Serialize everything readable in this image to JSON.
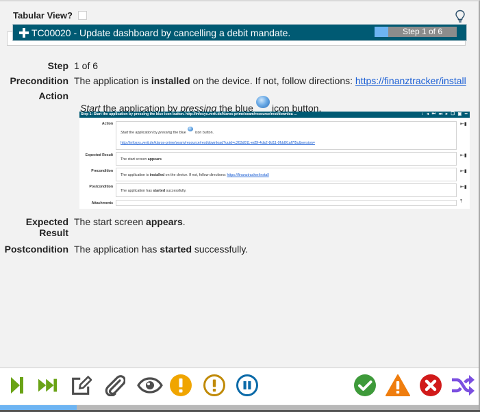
{
  "header": {
    "tabular_view_label": "Tabular View?",
    "tabular_view_checked": false,
    "test_case_title": "TC00020 - Update dashboard by cancelling a debit mandate.",
    "step_progress_label": "Step 1 of 6",
    "step_progress_fraction": 0.1667
  },
  "details": {
    "step_label": "Step",
    "step_value": "1 of 6",
    "precondition_label": "Precondition",
    "precondition_text_1": "The application is ",
    "precondition_bold": "installed",
    "precondition_text_2": " on the device. If not, follow directions: ",
    "precondition_link": "https://finanztracker/install",
    "action_label": "Action",
    "action_italic_1": "Start",
    "action_text_1": " the application by ",
    "action_italic_2": "pressing",
    "action_text_2": " the blue",
    "action_text_3": "icon button.",
    "expected_label": "Expected Result",
    "expected_text_1": "The start screen ",
    "expected_bold": "appears",
    "expected_text_2": ".",
    "postcondition_label": "Postcondition",
    "postcondition_text_1": "The application has ",
    "postcondition_bold": "started",
    "postcondition_text_2": " successfully."
  },
  "embedded_screenshot": {
    "title": "Step 1: Start the application by pressing the blue icon button. http://infosys.verit.de/klaros-prime/seam/resource/rest/downloa ...",
    "toolbar_glyphs": "↕ ◂ ⏮ ⏭ ▸ ❐ ▣ ━",
    "action_label": "Action",
    "action_italic_1": "Start",
    "action_text_1": " the application by ",
    "action_italic_2": "pressing",
    "action_text_2": " the blue ",
    "action_text_3": " icon button.",
    "action_link": "http://infosys.verit.de/klaros-prime/seam/resource/rest/download?uuid=c203d011-ed5f-4da2-8d11-0fdd01af7f5c&version=",
    "expected_label": "Expected Result",
    "expected_text_1": "The start screen ",
    "expected_bold": "appears",
    "precondition_label": "Precondition",
    "precondition_text_1": "The application is ",
    "precondition_bold": "installed",
    "precondition_text_2": " on the device. If not, follow directions: ",
    "precondition_link": "https://finanztracker/install",
    "postcondition_label": "Postcondition",
    "postcondition_text_1": "The application has ",
    "postcondition_bold": "started",
    "postcondition_text_2": " successfully.",
    "attachments_label": "Attachments"
  },
  "toolbar": {
    "left_buttons": [
      {
        "name": "step-forward",
        "color": "#6aa316"
      },
      {
        "name": "fast-forward",
        "color": "#6aa316"
      },
      {
        "name": "edit",
        "color": "#4d4d4d"
      },
      {
        "name": "attachment",
        "color": "#4d4d4d"
      },
      {
        "name": "view",
        "color": "#4d4d4d"
      },
      {
        "name": "warning-filled",
        "color": "#f0a500"
      },
      {
        "name": "warning-outline",
        "color": "#c08a08"
      },
      {
        "name": "pause",
        "color": "#0b6aa8"
      }
    ],
    "right_buttons": [
      {
        "name": "passed",
        "color": "#3e9a3a"
      },
      {
        "name": "error",
        "color": "#ef7d0e"
      },
      {
        "name": "failed",
        "color": "#d11a1a"
      },
      {
        "name": "skip",
        "color": "#7b4fe0"
      }
    ],
    "overall_progress_fraction": 0.16
  }
}
